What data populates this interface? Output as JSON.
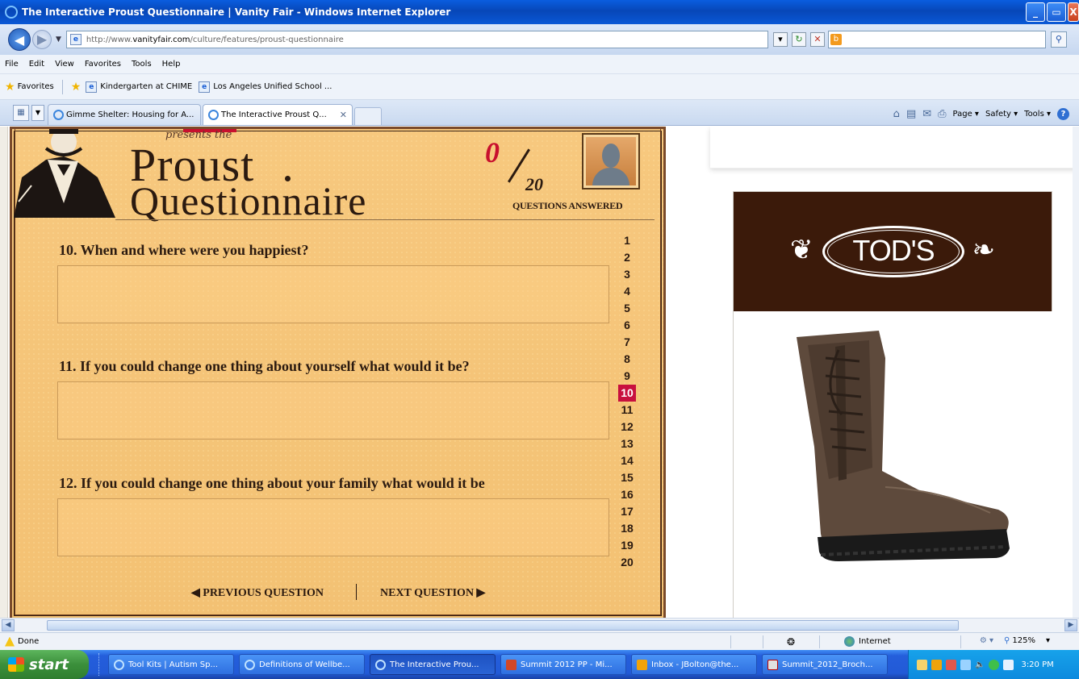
{
  "window": {
    "title": "The Interactive Proust Questionnaire | Vanity Fair - Windows Internet Explorer",
    "min_label": "_",
    "max_label": "▭",
    "close_label": "X"
  },
  "address": {
    "url_prefix": "http://www.",
    "url_host": "vanityfair.com",
    "url_path": "/culture/features/proust-questionnaire",
    "refresh_icon": "↻",
    "stop_icon": "✕",
    "search_value": "",
    "search_go_icon": "⚲"
  },
  "menu": [
    "File",
    "Edit",
    "View",
    "Favorites",
    "Tools",
    "Help"
  ],
  "favorites": {
    "label": "Favorites",
    "links": [
      "Kindergarten at CHIME",
      "Los Angeles Unified School ..."
    ]
  },
  "tabs": [
    {
      "label": "Gimme Shelter: Housing for A...",
      "active": false
    },
    {
      "label": "The Interactive Proust Q...",
      "active": true
    }
  ],
  "commands": {
    "page": "Page ▾",
    "safety": "Safety ▾",
    "tools": "Tools ▾",
    "help": "?"
  },
  "questionnaire": {
    "presents": "presents the",
    "title_line1": "Proust",
    "title_line2": "Questionnaire",
    "answered_count": "0",
    "total": "20",
    "answered_caption": "QUESTIONS ANSWERED",
    "questions": [
      {
        "text": "10. When and where were you happiest?",
        "answer": ""
      },
      {
        "text": "11. If you could change one thing about yourself what would it be?",
        "answer": ""
      },
      {
        "text": "12. If you could change one thing about your family what would it be",
        "answer": ""
      }
    ],
    "question_numbers": [
      "1",
      "2",
      "3",
      "4",
      "5",
      "6",
      "7",
      "8",
      "9",
      "10",
      "11",
      "12",
      "13",
      "14",
      "15",
      "16",
      "17",
      "18",
      "19",
      "20"
    ],
    "current_question": "10",
    "prev_label": "◀ PREVIOUS QUESTION",
    "next_label": "NEXT QUESTION ▶"
  },
  "ad": {
    "brand": "TOD'S",
    "accent": "#3b1a0a"
  },
  "status": {
    "text": "Done",
    "zone": "Internet",
    "zoom": "125%"
  },
  "taskbar": {
    "start_label": "start",
    "buttons": [
      {
        "label": "Tool Kits | Autism Sp...",
        "icon": "ie"
      },
      {
        "label": "Definitions of Wellbe...",
        "icon": "ie"
      },
      {
        "label": "The Interactive Prou...",
        "icon": "ie",
        "active": true
      },
      {
        "label": "Summit 2012 PP - Mi...",
        "icon": "ppt"
      },
      {
        "label": "Inbox - JBolton@the...",
        "icon": "outlook"
      },
      {
        "label": "Summit_2012_Broch...",
        "icon": "pdf"
      }
    ],
    "clock": "3:20 PM"
  },
  "colors": {
    "titlebar_blue": "#0747b8",
    "panel_parchment": "#f6c679",
    "current_q_red": "#c8103e",
    "taskbar_blue": "#245edb",
    "start_green": "#3b8f3b"
  }
}
